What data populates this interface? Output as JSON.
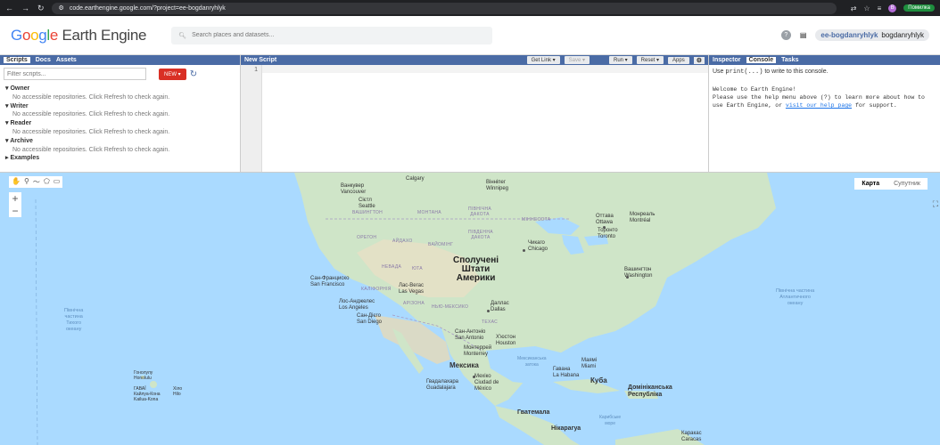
{
  "browser": {
    "url": "code.earthengine.google.com/?project=ee-bogdanryhlyk",
    "error_label": "Помилка",
    "avatar_letter": "В"
  },
  "app": {
    "logo_google": [
      "G",
      "o",
      "o",
      "g",
      "l",
      "e"
    ],
    "logo_product": "Earth Engine",
    "search_placeholder": "Search places and datasets...",
    "project": "ee-bogdanryhlyk",
    "username": "bogdanryhlyk"
  },
  "left_panel": {
    "tabs": [
      "Scripts",
      "Docs",
      "Assets"
    ],
    "filter_placeholder": "Filter scripts...",
    "new_label": "NEW ▾",
    "repos": [
      {
        "name": "Owner",
        "message": "No accessible repositories. Click Refresh to check again."
      },
      {
        "name": "Writer",
        "message": "No accessible repositories. Click Refresh to check again."
      },
      {
        "name": "Reader",
        "message": "No accessible repositories. Click Refresh to check again."
      },
      {
        "name": "Archive",
        "message": "No accessible repositories. Click Refresh to check again."
      }
    ],
    "examples_label": "Examples"
  },
  "editor": {
    "title": "New Script",
    "buttons": {
      "get_link": "Get Link ▾",
      "save": "Save ▾",
      "run": "Run ▾",
      "reset": "Reset ▾",
      "apps": "Apps"
    },
    "line_number": "1"
  },
  "right_panel": {
    "tabs": [
      "Inspector",
      "Console",
      "Tasks"
    ],
    "hint_pre": "Use ",
    "hint_code": "print(...)",
    "hint_post": " to write to this console.",
    "welcome_title": "Welcome to Earth Engine!",
    "welcome_body": "Please use the help menu above (?) to learn more about how to use Earth Engine, or ",
    "welcome_link": "visit our help page",
    "welcome_tail": " for support."
  },
  "map": {
    "type_map": "Карта",
    "type_satellite": "Супутник",
    "labels": {
      "calgary": "Calgary",
      "vancouver": "Ванкувер\nVancouver",
      "winnipeg": "Вінніпег\nWinnipeg",
      "seattle": "Сієтл\nSeattle",
      "washington_st": "ВАШИНГТОН",
      "montana": "МОНТАНА",
      "north_dakota": "ПІВНІЧНА\nДАКОТА",
      "minnesota": "МІННЕСОТА",
      "oregon": "ОРЕГОН",
      "idaho": "АЙДАХО",
      "wyoming": "ВАЙОМІНГ",
      "south_dakota": "ПІВДЕННА\nДАКОТА",
      "ottawa": "Оттава\nOttawa",
      "montreal": "Монреаль\nMontréal",
      "toronto": "Торонто\nToronto",
      "chicago": "Чикаго\nChicago",
      "usa": "Сполучені\nШтати\nАмерики",
      "nevada": "НЕВАДА",
      "utah": "ЮТА",
      "sf": "Сан-Франциско\nSan Francisco",
      "california": "КАЛІФОРНІЯ",
      "las_vegas": "Лас-Вегас\nLas Vegas",
      "washington_dc": "Вашингтон\nWashington",
      "la": "Лос-Анджелес\nLos Angeles",
      "arizona": "АРІЗОНА",
      "new_mexico": "НЬЮ-МЕКСИКО",
      "dallas": "Даллас\nDallas",
      "san_diego": "Сан-Дієго\nSan Diego",
      "texas": "ТЕХАС",
      "san_antonio": "Сан-Антоніо\nSan Antonio",
      "houston": "Х'юстон\nHouston",
      "monterrey": "Монтеррей\nMonterrey",
      "mexico": "Мексика",
      "mexico_city": "Мехіко\nCiudad de\nMéxico",
      "guadalajara": "Гвадалахара\nGuadalajara",
      "havana": "Гавана\nLa Habana",
      "cuba": "Куба",
      "miami": "Маямі\nMiami",
      "dominican": "Домініканська\nРеспубліка",
      "guatemala": "Гватемала",
      "nicaragua": "Нікарагуа",
      "caracas": "Каракас\nCaracas",
      "honolulu": "Гонолулу\nHonolulu",
      "hawaii": "ГАВАЇ\nКайлуа-Кона\nKailua-Kona",
      "hilo": "Хіло\nHilo",
      "pacific": "Північна\nчастина\nТихого\nокеану",
      "atlantic": "Північна частина\nАтлантичного\nокеану",
      "gulf": "Мексиканська\nзатока",
      "caribbean": "Карибське\nморе"
    }
  }
}
